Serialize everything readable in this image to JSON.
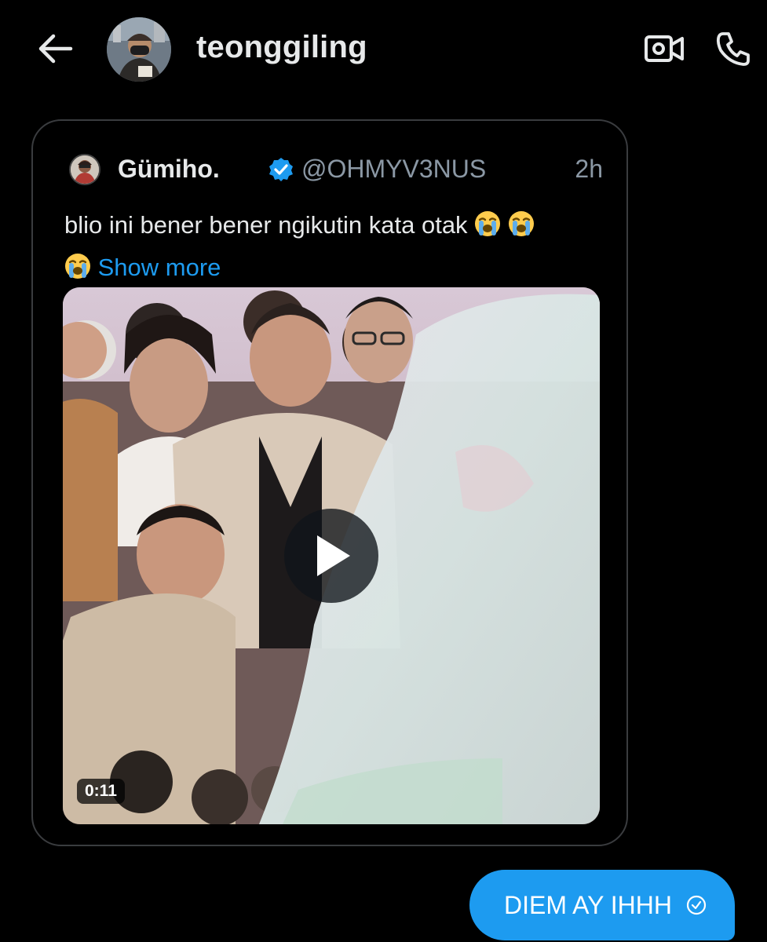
{
  "header": {
    "username": "teonggiling",
    "back_icon": "arrow-left-icon",
    "video_icon": "video-camera-icon",
    "call_icon": "phone-icon"
  },
  "quoted_post": {
    "author_name": "Gümiho.",
    "verified": true,
    "handle": "@OHMYV3NUS",
    "time": "2h",
    "text": "blio ini bener bener ngikutin kata otak",
    "emojis": [
      "loudly-crying-face",
      "loudly-crying-face",
      "loudly-crying-face"
    ],
    "show_more": "Show more",
    "video_duration": "0:11"
  },
  "message": {
    "text": "DIEM AY IHHH",
    "status_icon": "sent-check-icon"
  },
  "colors": {
    "background": "#000000",
    "accent": "#1d9bf0",
    "text_primary": "#e7e9ea",
    "text_secondary": "#8b98a5",
    "card_border": "#3a3c3f"
  }
}
